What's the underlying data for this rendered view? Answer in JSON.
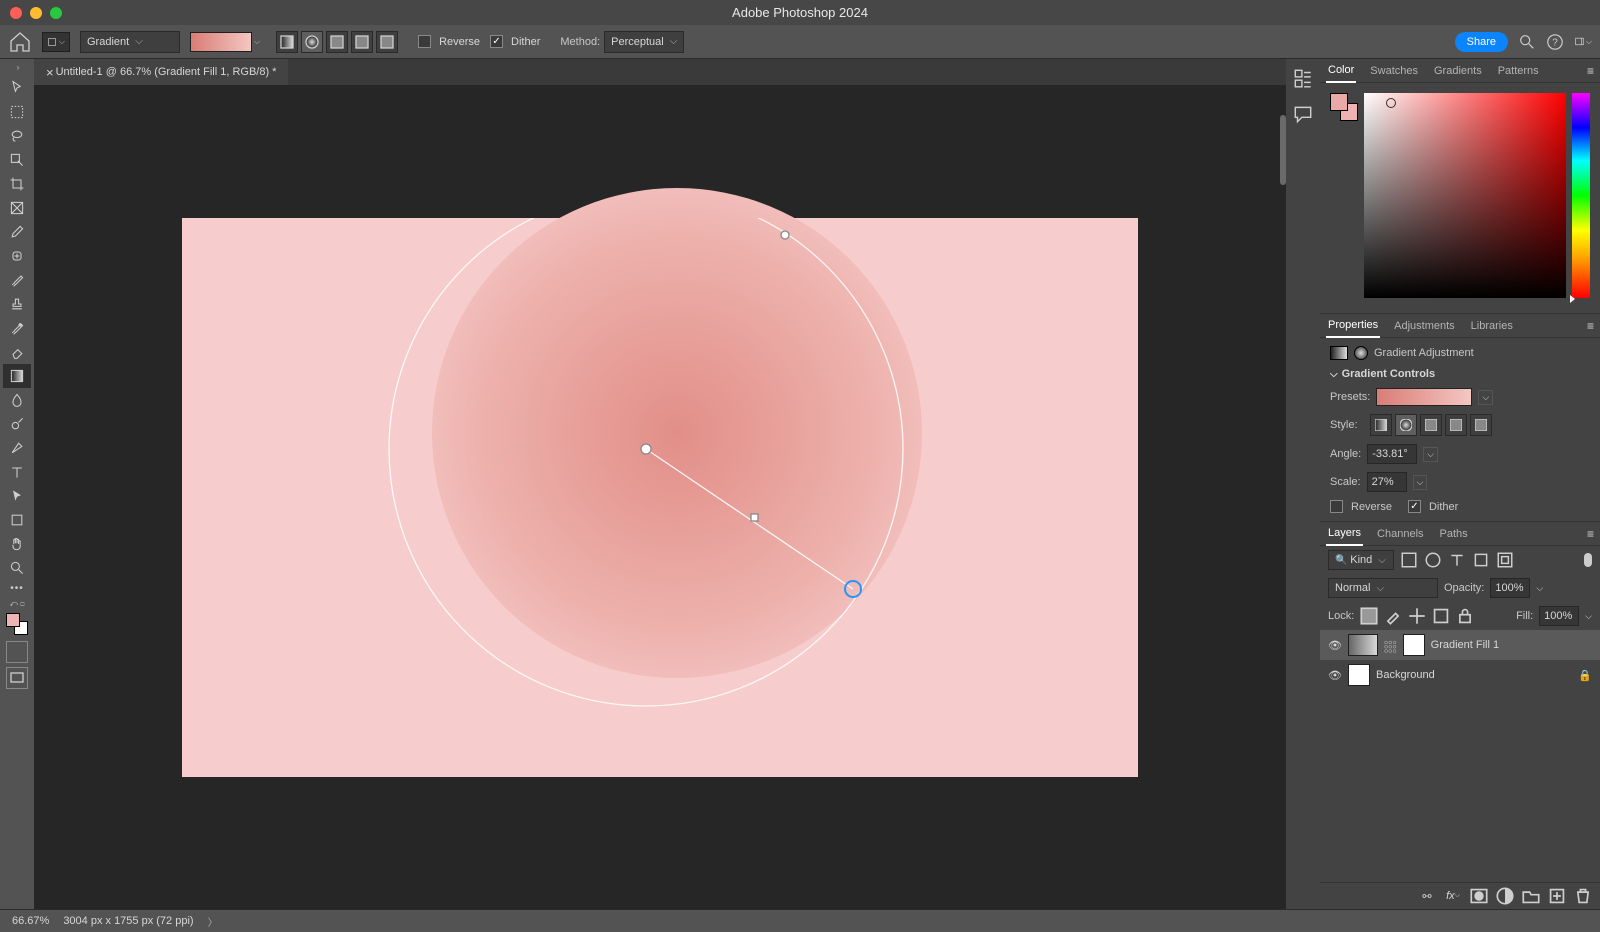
{
  "app_title": "Adobe Photoshop 2024",
  "optbar": {
    "preset_label": "Gradient",
    "reverse": "Reverse",
    "dither": "Dither",
    "method_label": "Method:",
    "method_value": "Perceptual",
    "share": "Share"
  },
  "document": {
    "tab_title": "Untitled-1 @ 66.7% (Gradient Fill 1, RGB/8) *"
  },
  "panels": {
    "color": {
      "tabs": [
        "Color",
        "Swatches",
        "Gradients",
        "Patterns"
      ]
    },
    "props": {
      "tabs": [
        "Properties",
        "Adjustments",
        "Libraries"
      ],
      "adjustment": "Gradient Adjustment",
      "section": "Gradient Controls",
      "presets_label": "Presets:",
      "style_label": "Style:",
      "angle_label": "Angle:",
      "angle_value": "-33.81°",
      "scale_label": "Scale:",
      "scale_value": "27%",
      "reverse": "Reverse",
      "dither": "Dither"
    },
    "layers": {
      "tabs": [
        "Layers",
        "Channels",
        "Paths"
      ],
      "kind": "Kind",
      "blend": "Normal",
      "opacity_label": "Opacity:",
      "opacity_value": "100%",
      "lock_label": "Lock:",
      "fill_label": "Fill:",
      "fill_value": "100%",
      "layer1": "Gradient Fill 1",
      "layer2": "Background"
    }
  },
  "status": {
    "zoom": "66.67%",
    "doc_info": "3004 px x 1755 px (72 ppi)"
  },
  "tools": [
    "move",
    "artboard",
    "lasso",
    "wand",
    "crop",
    "frame",
    "dropper",
    "healing",
    "brush",
    "stamp",
    "history",
    "eraser",
    "gradient",
    "blur",
    "dodge",
    "pen",
    "type",
    "path",
    "shape",
    "hand",
    "zoom"
  ]
}
